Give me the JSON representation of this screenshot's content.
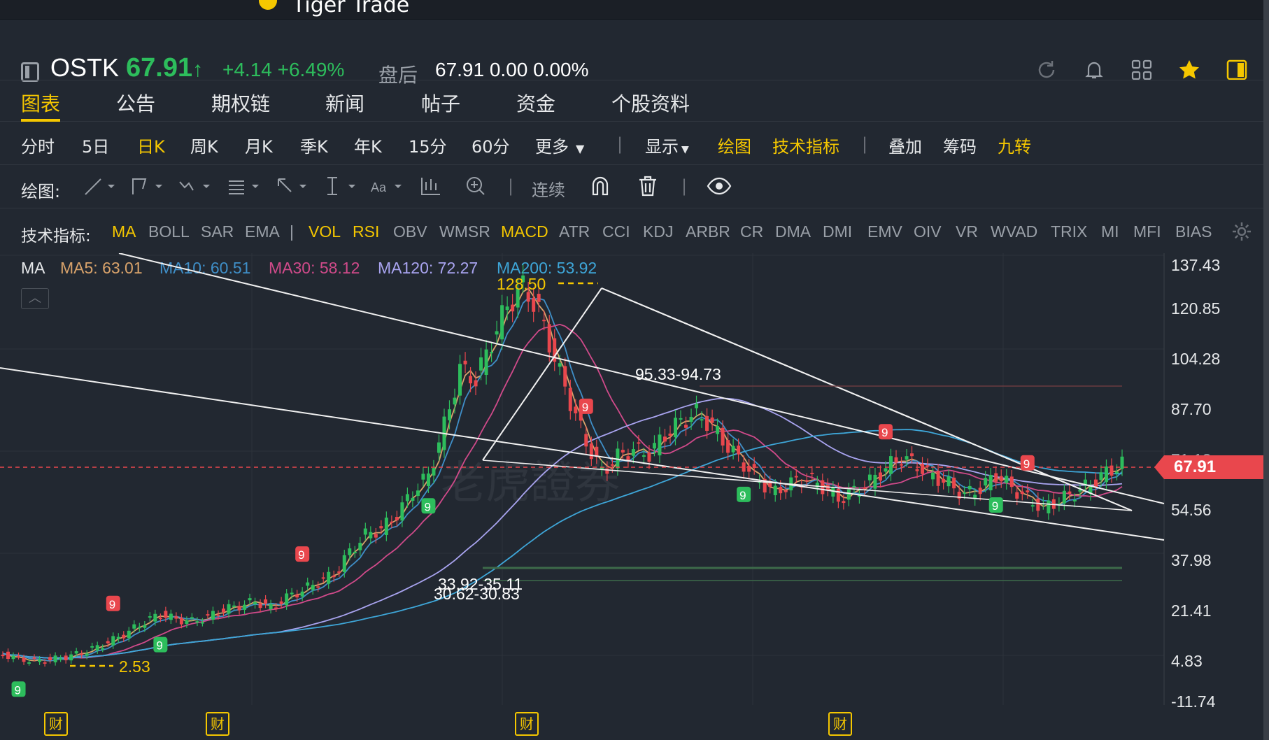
{
  "window": {
    "title": "Tiger Trade"
  },
  "quote": {
    "symbol": "OSTK",
    "price": "67.91",
    "arrow": "↑",
    "change": "+4.14 +6.49%",
    "after_hours_label": "盘后",
    "after_hours_value": "67.91 0.00 0.00%"
  },
  "header_icons": [
    "refresh-icon",
    "bell-icon",
    "grid-icon",
    "star-icon",
    "panel-icon"
  ],
  "tabs": [
    {
      "label": "图表",
      "active": true
    },
    {
      "label": "公告"
    },
    {
      "label": "期权链"
    },
    {
      "label": "新闻"
    },
    {
      "label": "帖子"
    },
    {
      "label": "资金"
    },
    {
      "label": "个股资料"
    }
  ],
  "periods": {
    "items": [
      "分时",
      "5日",
      "日K",
      "周K",
      "月K",
      "季K",
      "年K",
      "15分",
      "60分",
      "更多"
    ],
    "active": "日K",
    "display": "显示",
    "draw": "绘图",
    "indicators": "技术指标",
    "overlay": "叠加",
    "chips": "筹码",
    "nine": "九转"
  },
  "drawbar": {
    "label": "绘图:",
    "continuous": "连续",
    "tools": [
      "line-tool-icon",
      "path-tool-icon",
      "wave-tool-icon",
      "fib-tool-icon",
      "arrow-tool-icon",
      "measure-tool-icon",
      "text-tool-icon",
      "candle-tool-icon",
      "zoom-icon",
      "magnet-icon",
      "trash-icon",
      "eye-icon"
    ]
  },
  "indicators": {
    "label": "技术指标:",
    "items": [
      "MA",
      "BOLL",
      "SAR",
      "EMA",
      "|",
      "VOL",
      "RSI",
      "OBV",
      "WMSR",
      "MACD",
      "ATR",
      "CCI",
      "KDJ",
      "ARBR",
      "CR",
      "DMA",
      "DMI",
      "EMV",
      "OIV",
      "VR",
      "WVAD",
      "TRIX",
      "MI",
      "MFI",
      "BIAS"
    ],
    "active": [
      "MA",
      "VOL",
      "RSI",
      "MACD"
    ]
  },
  "ma_legend": {
    "name": "MA",
    "items": [
      {
        "label": "MA5: 63.01",
        "color": "#d9a36b"
      },
      {
        "label": "MA10: 60.51",
        "color": "#3f8fc8"
      },
      {
        "label": "MA30: 58.12",
        "color": "#d04a8a"
      },
      {
        "label": "MA120: 72.27",
        "color": "#a9a4f0"
      },
      {
        "label": "MA200: 53.92",
        "color": "#3ea6d8"
      }
    ]
  },
  "colors": {
    "up": "#2dbd5c",
    "down": "#e9474d",
    "accent": "#f5c700",
    "bg": "#222831"
  },
  "chart_data": {
    "type": "candlestick",
    "y_ticks": [
      "137.43",
      "120.85",
      "104.28",
      "87.70",
      "71.13",
      "54.56",
      "37.98",
      "21.41",
      "4.83",
      "-11.74"
    ],
    "ylim": [
      -11.74,
      137.43
    ],
    "last_price": "67.91",
    "annotations": [
      {
        "text": "128.50",
        "kind": "high"
      },
      {
        "text": "2.53",
        "kind": "low"
      },
      {
        "text": "95.33-94.73",
        "kind": "gap"
      },
      {
        "text": "33.92-35.11",
        "kind": "gap"
      },
      {
        "text": "30.62-30.83",
        "kind": "gap"
      }
    ],
    "nine_markers": [
      "9",
      "9",
      "9",
      "9",
      "9",
      "9",
      "9",
      "9",
      "9",
      "9"
    ],
    "fin_label": "财",
    "close_path": [
      5,
      3.5,
      2.8,
      3.2,
      4.1,
      5.5,
      7.4,
      9.8,
      12.5,
      15.8,
      18.2,
      16.5,
      15.9,
      17.4,
      19.8,
      21.0,
      22.5,
      20.3,
      23.8,
      26.1,
      28.9,
      31.4,
      38.8,
      44.5,
      46.3,
      51.2,
      58.6,
      64.0,
      80.5,
      99.2,
      95.6,
      108.4,
      120.2,
      126.4,
      118.3,
      102.7,
      88.5,
      74.9,
      65.2,
      70.3,
      72.6,
      71.1,
      77.4,
      81.9,
      84.6,
      80.2,
      73.5,
      67.8,
      62.1,
      58.4,
      61.6,
      63.2,
      60.4,
      56.3,
      58.8,
      62.0,
      66.5,
      70.1,
      67.3,
      63.9,
      61.2,
      57.6,
      59.8,
      64.3,
      60.1,
      56.2,
      53.4,
      55.8,
      58.4,
      61.1,
      65.0,
      67.9
    ]
  }
}
